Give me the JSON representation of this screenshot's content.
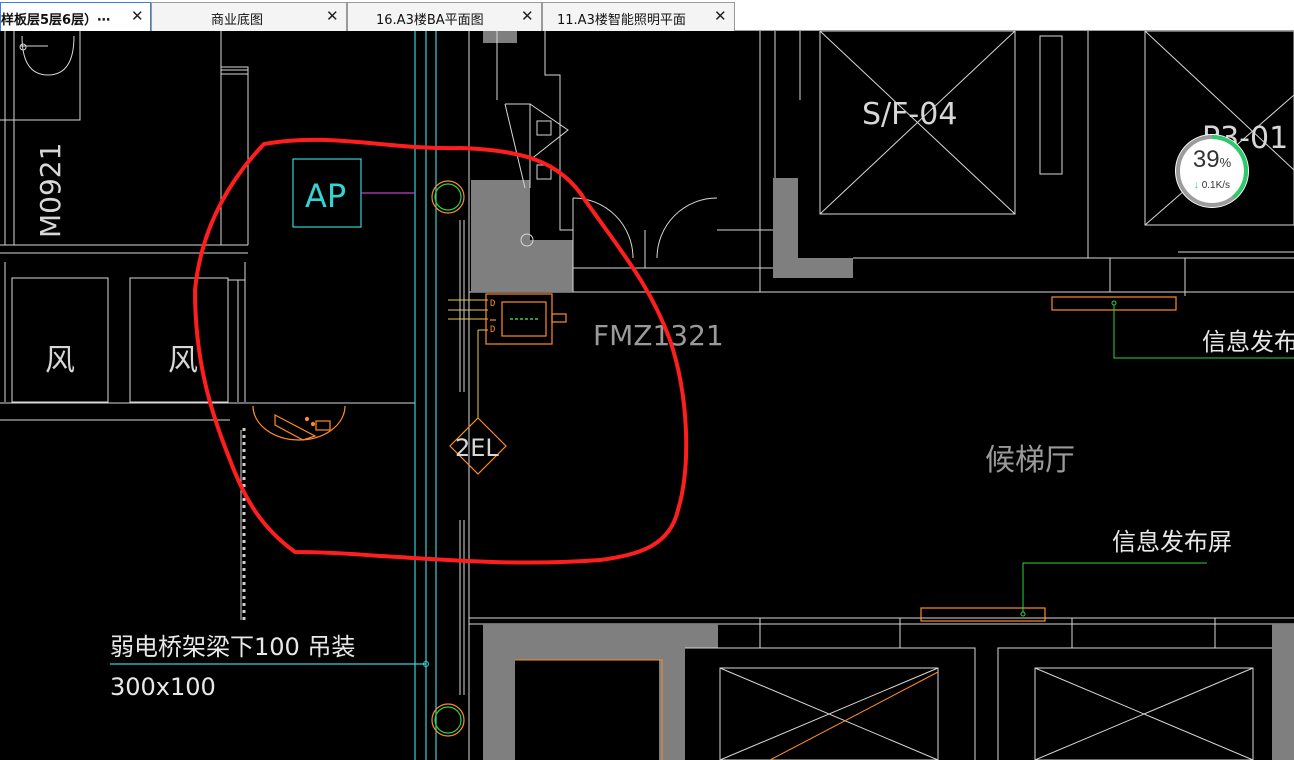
{
  "tabs": [
    {
      "label": "样板层5层6层）",
      "ellipsis": "⋯",
      "close": "✕",
      "active": true
    },
    {
      "label": "商业底图",
      "close": "✕",
      "active": false
    },
    {
      "label": "16.A3楼BA平面图",
      "close": "✕",
      "active": false
    },
    {
      "label": "11.A3楼智能照明平面",
      "close": "✕",
      "active": false
    }
  ],
  "drawing": {
    "door_tag": "M0921",
    "room_codes": [
      "S/F-04",
      "P3-01"
    ],
    "shaft_label": "风",
    "ap_label": "AP",
    "device_2el": "2EL",
    "fire_door": "FMZ1321",
    "lobby": "候梯厅",
    "info_screen": "信息发布屏",
    "tray_note_line1": "弱电桥架梁下100 吊装",
    "tray_note_line2": "300x100"
  },
  "network_widget": {
    "percent": 39,
    "percent_sign": "%",
    "speed": "0.1K/s",
    "arrow": "↓"
  },
  "colors": {
    "background": "#000000",
    "wall": "#d7d7d7",
    "cyan": "#35d2d2",
    "orange": "#ff8c2a",
    "green": "#30d040",
    "red_markup": "#ff1e1e",
    "gray_fill": "#7f7f7f",
    "active_tab_border": "#3c7fd6"
  }
}
